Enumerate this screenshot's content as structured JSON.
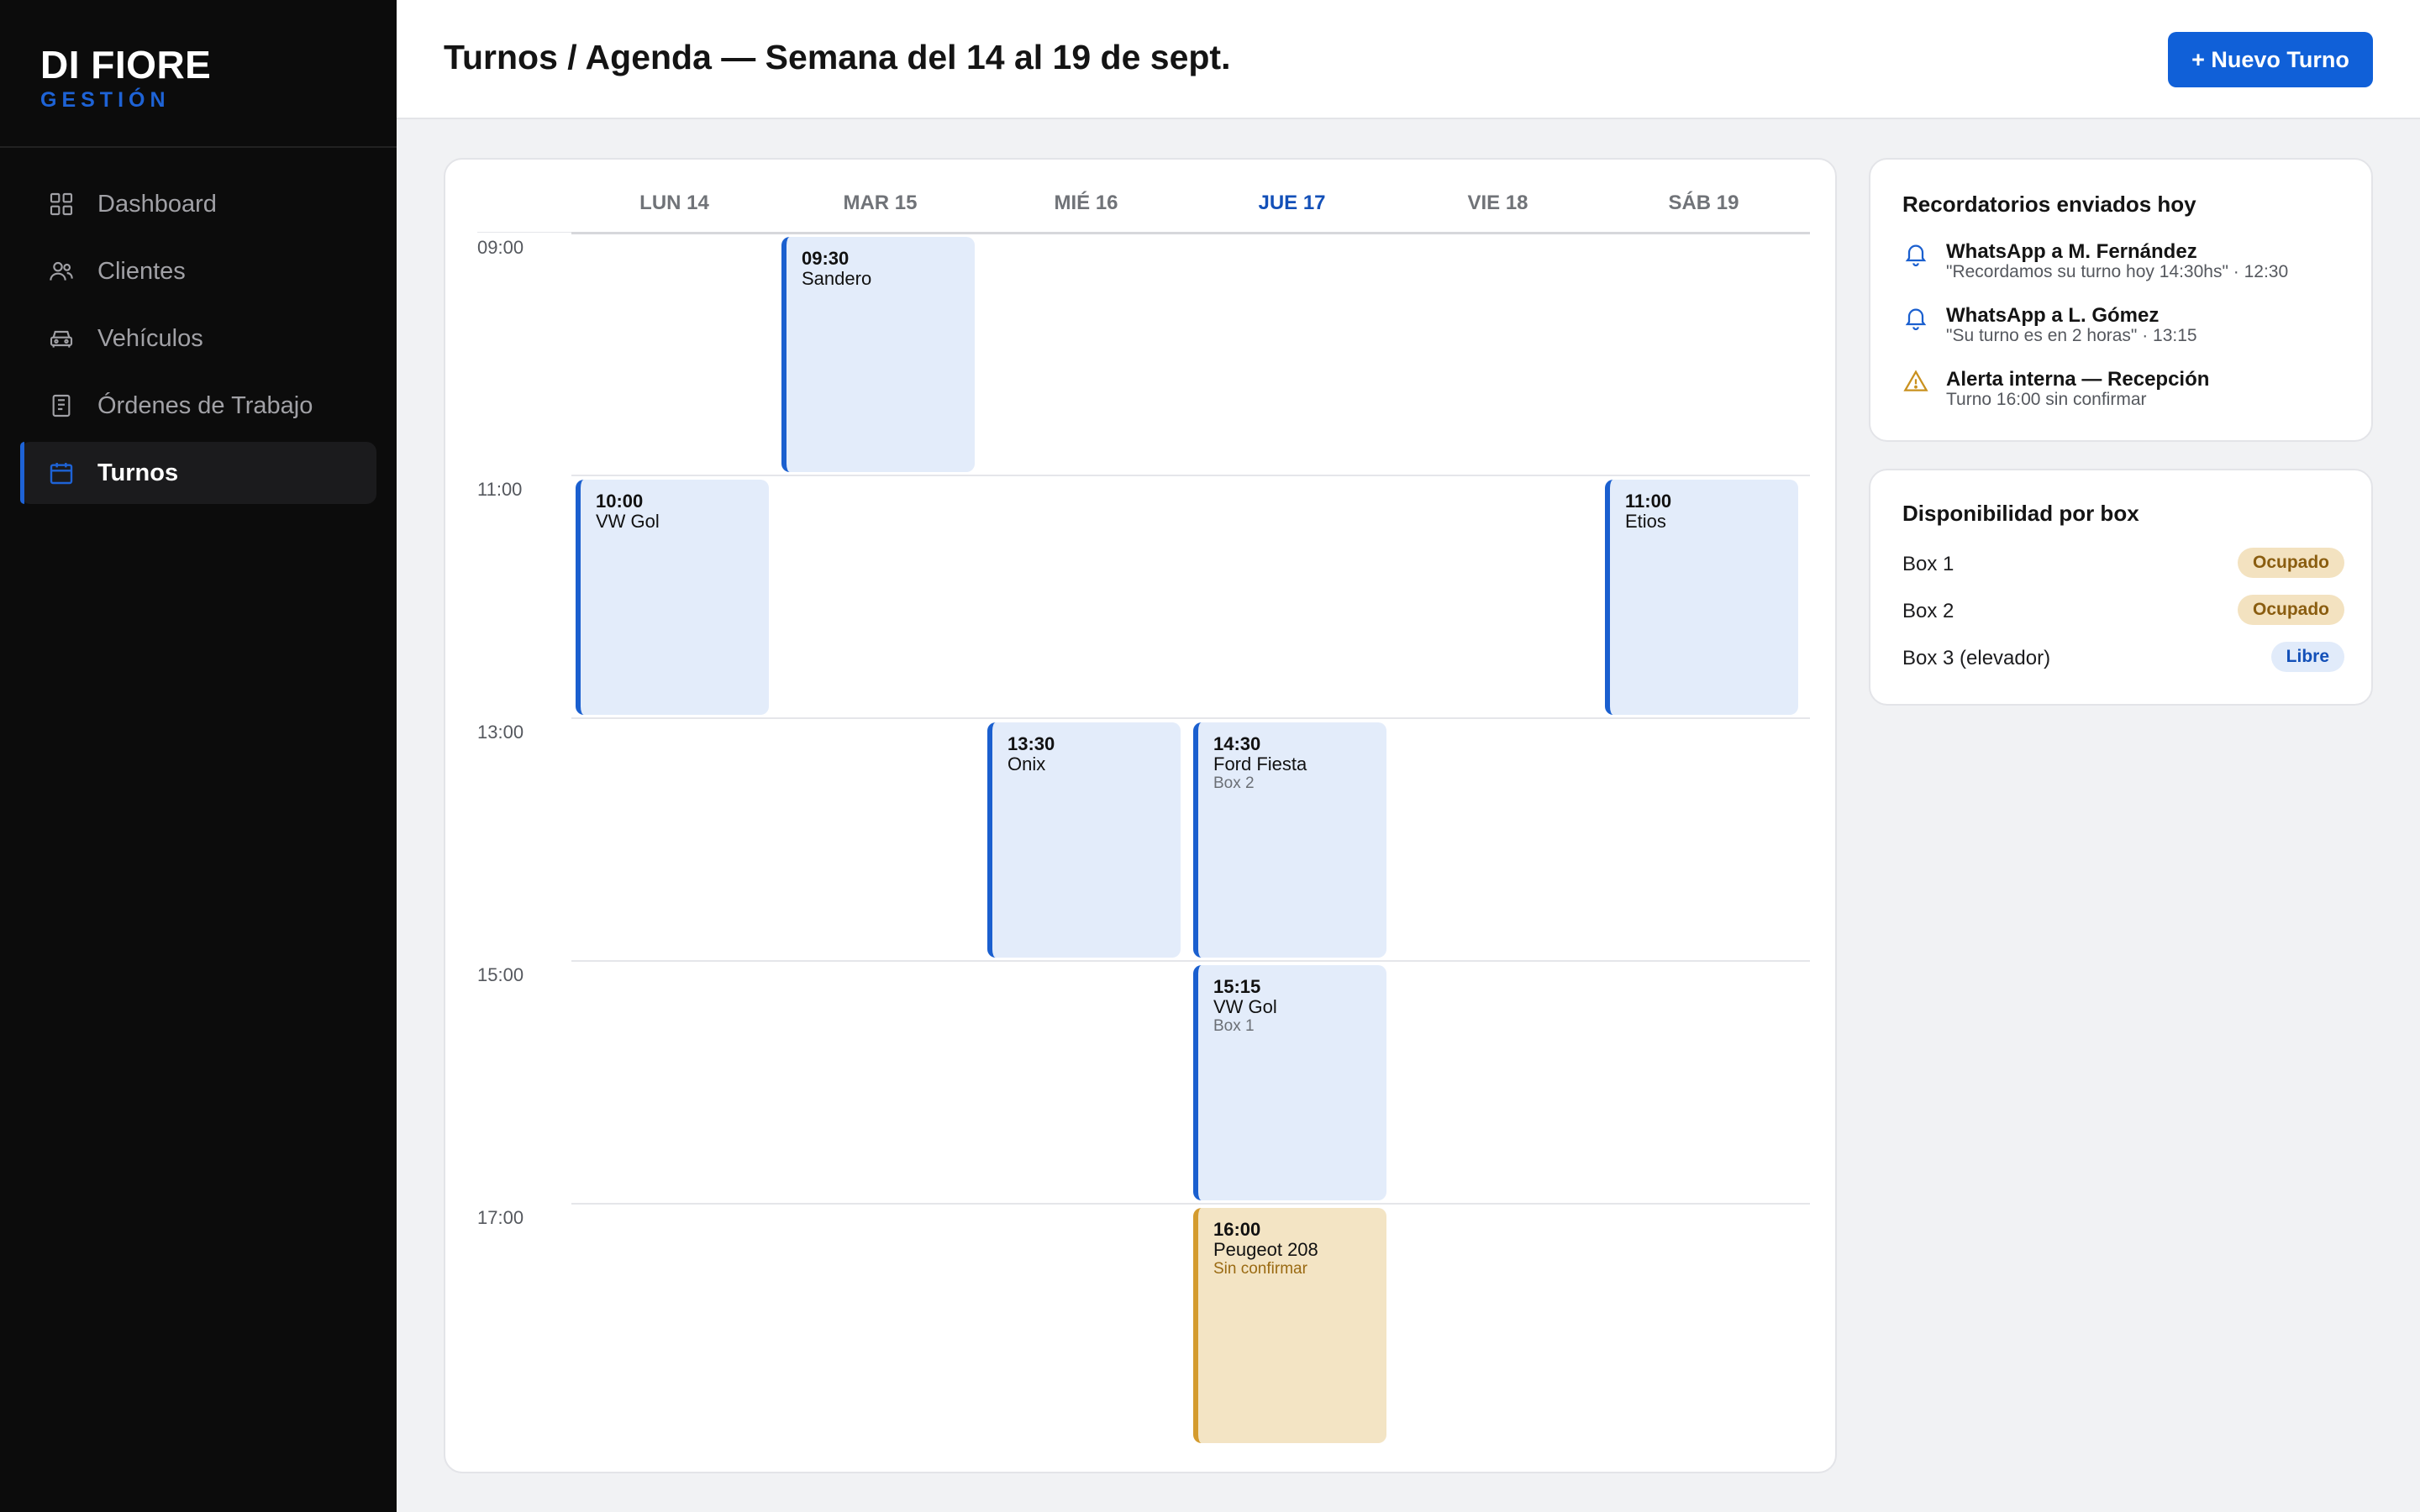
{
  "brand": {
    "name": "DI FIORE",
    "subtitle": "GESTIÓN"
  },
  "nav": [
    {
      "label": "Dashboard",
      "icon": "dashboard-grid-icon",
      "active": false
    },
    {
      "label": "Clientes",
      "icon": "users-icon",
      "active": false
    },
    {
      "label": "Vehículos",
      "icon": "car-icon",
      "active": false
    },
    {
      "label": "Órdenes de Trabajo",
      "icon": "clipboard-icon",
      "active": false
    },
    {
      "label": "Turnos",
      "icon": "calendar-icon",
      "active": true
    }
  ],
  "header": {
    "title": "Turnos / Agenda — Semana del 14 al 19 de sept.",
    "new_button": "+ Nuevo Turno"
  },
  "calendar": {
    "days": [
      "LUN 14",
      "MAR 15",
      "MIÉ 16",
      "JUE 17",
      "VIE 18",
      "SÁB 19"
    ],
    "today": "JUE 17",
    "hours": [
      "09:00",
      "11:00",
      "13:00",
      "15:00",
      "17:00"
    ],
    "appointments": [
      {
        "day": "MAR 15",
        "slot": "09:00",
        "time": "09:30",
        "vehicle": "Sandero",
        "note": "",
        "status": "confirmed"
      },
      {
        "day": "LUN 14",
        "slot": "11:00",
        "time": "10:00",
        "vehicle": "VW Gol",
        "note": "",
        "status": "confirmed"
      },
      {
        "day": "SÁB 19",
        "slot": "11:00",
        "time": "11:00",
        "vehicle": "Etios",
        "note": "",
        "status": "confirmed"
      },
      {
        "day": "MIÉ 16",
        "slot": "13:00",
        "time": "13:30",
        "vehicle": "Onix",
        "note": "",
        "status": "confirmed"
      },
      {
        "day": "JUE 17",
        "slot": "13:00",
        "time": "14:30",
        "vehicle": "Ford Fiesta",
        "note": "Box 2",
        "status": "confirmed"
      },
      {
        "day": "JUE 17",
        "slot": "15:00",
        "time": "15:15",
        "vehicle": "VW Gol",
        "note": "Box 1",
        "status": "confirmed"
      },
      {
        "day": "JUE 17",
        "slot": "17:00",
        "time": "16:00",
        "vehicle": "Peugeot 208",
        "note": "Sin confirmar",
        "status": "unconfirmed"
      }
    ]
  },
  "reminders": {
    "title": "Recordatorios enviados hoy",
    "items": [
      {
        "icon": "bell-icon",
        "title": "WhatsApp a M. Fernández",
        "subtitle": "\"Recordamos su turno hoy 14:30hs\" · 12:30"
      },
      {
        "icon": "bell-icon",
        "title": "WhatsApp a L. Gómez",
        "subtitle": "\"Su turno es en 2 horas\" · 13:15"
      },
      {
        "icon": "warning-icon",
        "title": "Alerta interna — Recepción",
        "subtitle": "Turno 16:00 sin confirmar"
      }
    ]
  },
  "availability": {
    "title": "Disponibilidad por box",
    "boxes": [
      {
        "label": "Box 1",
        "status": "Ocupado",
        "state": "busy"
      },
      {
        "label": "Box 2",
        "status": "Ocupado",
        "state": "busy"
      },
      {
        "label": "Box 3 (elevador)",
        "status": "Libre",
        "state": "free"
      }
    ]
  },
  "colors": {
    "sidebar_bg": "#0c0c0c",
    "accent": "#1060d8",
    "appointment_bg": "#e3ecfa",
    "unconfirmed_bg": "#f3e4c4",
    "warning": "#d49b2e"
  }
}
